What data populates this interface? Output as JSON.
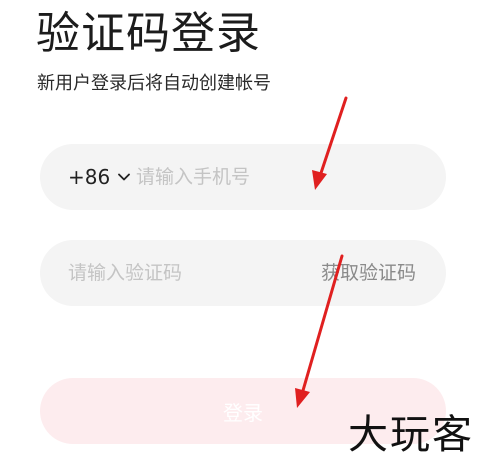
{
  "page": {
    "title": "验证码登录",
    "subtitle": "新用户登录后将自动创建帐号"
  },
  "phone": {
    "country_code": "+86",
    "placeholder": "请输入手机号",
    "value": ""
  },
  "code": {
    "placeholder": "请输入验证码",
    "value": "",
    "get_code_label": "获取验证码"
  },
  "login": {
    "label": "登录"
  },
  "watermark": {
    "text": "大玩客"
  },
  "colors": {
    "field_background": "#f4f4f4",
    "login_button_background": "#fdecee",
    "placeholder": "#c4c4c4",
    "annotation_arrow": "#e02020"
  },
  "icons": {
    "country_selector": "chevron-down-icon"
  }
}
